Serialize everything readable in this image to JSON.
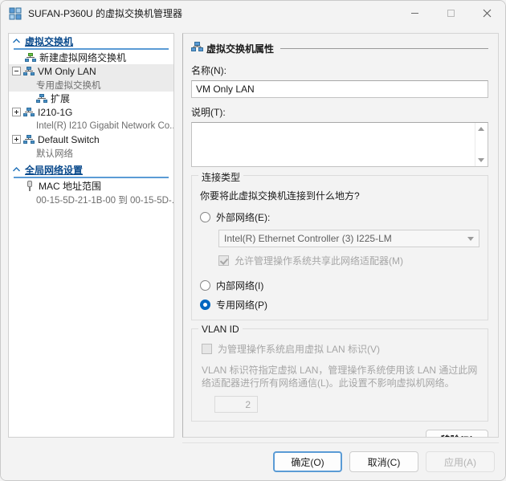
{
  "window": {
    "title": "SUFAN-P360U 的虚拟交换机管理器",
    "icon": "hyperv-switch-icon",
    "minimize": "—",
    "maximize": "□",
    "close": "✕"
  },
  "tree": {
    "groups": [
      {
        "label": "虚拟交换机",
        "icon": "chevron-up-icon",
        "items": [
          {
            "label": "新建虚拟网络交换机",
            "icon": "new-switch-icon",
            "expander": "none",
            "indent": 1,
            "selected": false,
            "sub": null
          },
          {
            "label": "VM Only LAN",
            "icon": "switch-icon",
            "expander": "expanded",
            "indent": 0,
            "selected": true,
            "sub": "专用虚拟交换机"
          },
          {
            "label": "扩展",
            "icon": "switch-icon",
            "expander": "none",
            "indent": 2,
            "selected": false,
            "sub": null
          },
          {
            "label": "I210-1G",
            "icon": "switch-icon",
            "expander": "collapsed",
            "indent": 0,
            "selected": false,
            "sub": "Intel(R) I210 Gigabit Network Co..."
          },
          {
            "label": "Default Switch",
            "icon": "switch-icon",
            "expander": "collapsed",
            "indent": 0,
            "selected": false,
            "sub": "默认网络"
          }
        ]
      },
      {
        "label": "全局网络设置",
        "icon": "chevron-up-icon",
        "items": [
          {
            "label": "MAC 地址范围",
            "icon": "mac-icon",
            "expander": "none",
            "indent": 1,
            "selected": false,
            "sub": "00-15-5D-21-1B-00 到 00-15-5D-..."
          }
        ]
      }
    ]
  },
  "right": {
    "section_title": "虚拟交换机属性",
    "section_icon": "switch-icon",
    "name_label": "名称(N):",
    "name_value": "VM Only LAN",
    "desc_label": "说明(T):",
    "desc_value": "",
    "connection": {
      "group_label": "连接类型",
      "question": "你要将此虚拟交换机连接到什么地方?",
      "options": [
        {
          "label": "外部网络(E):",
          "checked": false
        },
        {
          "label": "内部网络(I)",
          "checked": false
        },
        {
          "label": "专用网络(P)",
          "checked": true
        }
      ],
      "adapter_value": "Intel(R) Ethernet Controller (3) I225-LM",
      "share_checkbox_label": "允许管理操作系统共享此网络适配器(M)",
      "share_checkbox_checked": true,
      "share_checkbox_disabled": true
    },
    "vlan": {
      "group_label": "VLAN ID",
      "enable_label": "为管理操作系统启用虚拟 LAN 标识(V)",
      "enable_checked": false,
      "description": "VLAN 标识符指定虚拟 LAN，管理操作系统使用该 LAN 通过此网络适配器进行所有网络通信(L)。此设置不影响虚拟机网络。",
      "id_value": "2"
    },
    "remove_button": "移除(R)"
  },
  "footer": {
    "ok": "确定(O)",
    "cancel": "取消(C)",
    "apply": "应用(A)"
  },
  "colors": {
    "accent": "#0067c0",
    "group_header": "#0a4a8c",
    "group_rule": "#5b9bd5",
    "window_bg": "#f3f3f3",
    "selection": "#ebebeb"
  }
}
